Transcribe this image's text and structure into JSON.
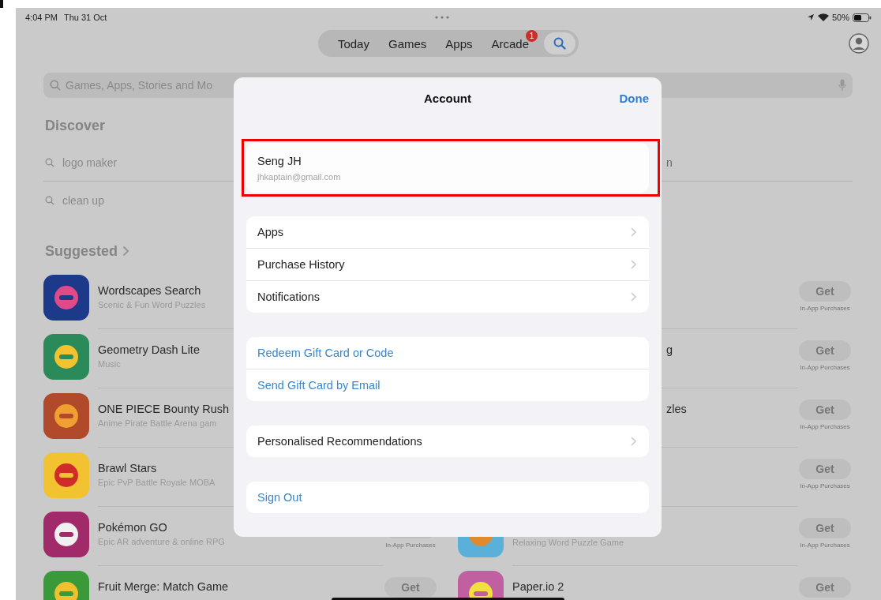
{
  "status_bar": {
    "time": "4:04 PM",
    "date": "Thu 31 Oct",
    "battery": "50%"
  },
  "tabs": [
    {
      "kind": "text",
      "label": "Today",
      "selected": false
    },
    {
      "kind": "text",
      "label": "Games",
      "selected": false
    },
    {
      "kind": "text",
      "label": "Apps",
      "selected": false
    },
    {
      "kind": "text",
      "label": "Arcade",
      "selected": false,
      "badge": "1"
    },
    {
      "kind": "search",
      "selected": true
    }
  ],
  "search": {
    "placeholder": "Games, Apps, Stories and Mo"
  },
  "discover": {
    "title": "Discover",
    "items": [
      {
        "text": "logo maker"
      },
      {
        "text": "clean up"
      }
    ],
    "right_items": [
      {
        "tail": "n"
      }
    ]
  },
  "suggested": {
    "title": "Suggested",
    "apps": [
      {
        "title": "Wordscapes Search",
        "subtitle": "Scenic & Fun Word Puzzles"
      },
      {
        "title": "Geometry Dash Lite",
        "subtitle": "Music"
      },
      {
        "title": "ONE PIECE Bounty Rush",
        "subtitle": "Anime Pirate Battle Arena gam"
      },
      {
        "title": "Brawl Stars",
        "subtitle": "Epic PvP Battle Royale MOBA"
      },
      {
        "title": "Pokémon GO",
        "subtitle": "Epic AR adventure & online RPG",
        "note": "In-App Purchases"
      },
      {
        "title": "Fruit Merge: Match Game",
        "button": "Get"
      }
    ],
    "right_apps": [
      {
        "button": "Get",
        "note": "In-App Purchases"
      },
      {
        "tail": "g",
        "button": "Get",
        "note": "In-App Purchases"
      },
      {
        "tail": "zles",
        "button": "Get",
        "note": "In-App Purchases"
      },
      {
        "button": "Get",
        "note": "In-App Purchases"
      },
      {
        "subtitle": "Relaxing Word Puzzle Game",
        "button": "Get",
        "note": "In-App Purchases"
      },
      {
        "title": "Paper.io 2",
        "button": "Get"
      }
    ]
  },
  "sheet": {
    "title": "Account",
    "done": "Done",
    "account": {
      "name": "Seng JH",
      "email": "jhkaptain@gmail.com",
      "highlighted": true
    },
    "groups": [
      [
        {
          "kind": "nav",
          "label": "Apps"
        },
        {
          "kind": "nav",
          "label": "Purchase History"
        },
        {
          "kind": "nav",
          "label": "Notifications"
        }
      ],
      [
        {
          "kind": "action",
          "label": "Redeem Gift Card or Code"
        },
        {
          "kind": "action",
          "label": "Send Gift Card by Email"
        }
      ],
      [
        {
          "kind": "nav",
          "label": "Personalised Recommendations"
        }
      ],
      [
        {
          "kind": "action",
          "label": "Sign Out"
        }
      ]
    ]
  }
}
